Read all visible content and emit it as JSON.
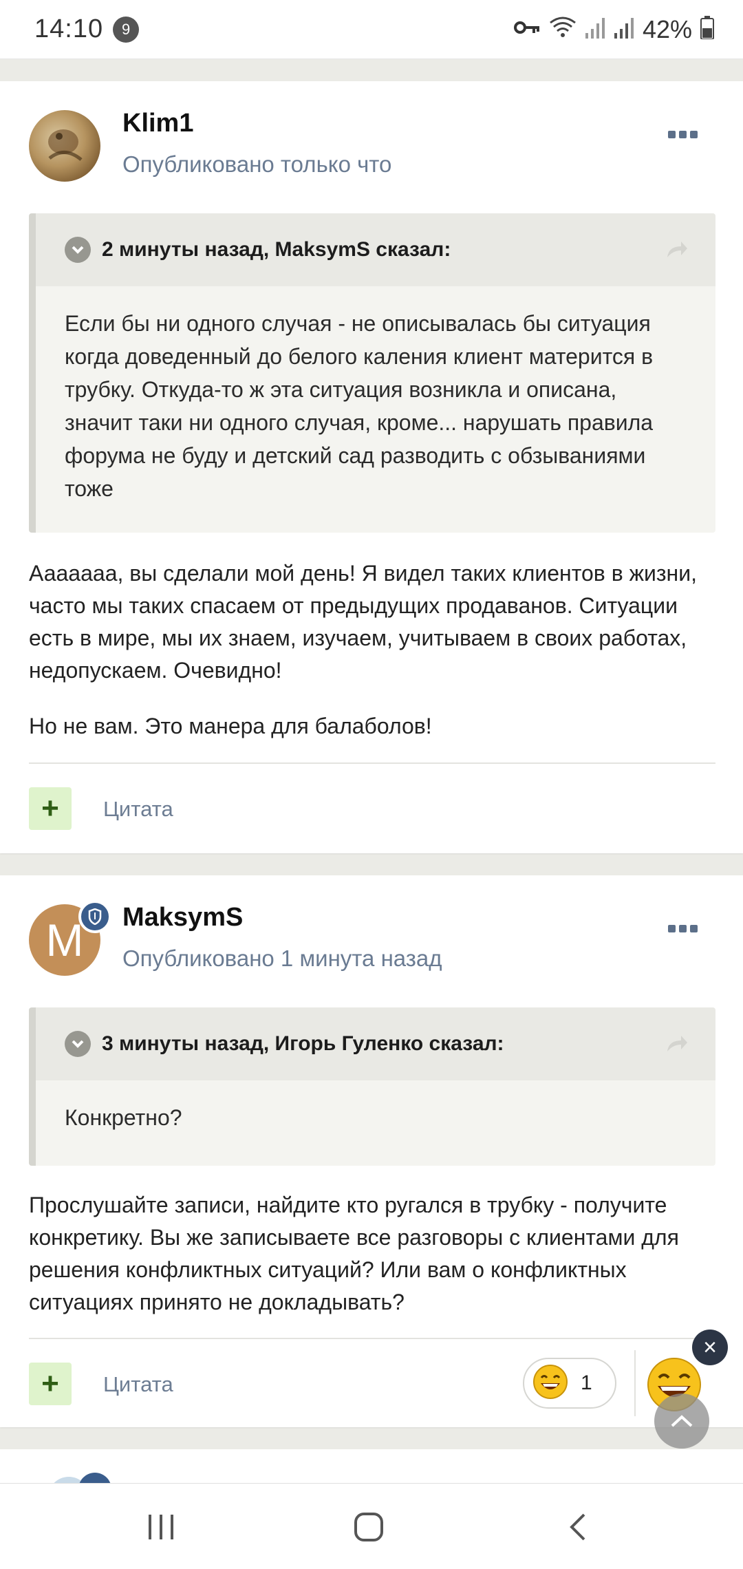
{
  "status_bar": {
    "time": "14:10",
    "notification_count": "9",
    "battery": "42%",
    "icons": [
      "key-icon",
      "wifi-icon",
      "signal-icon",
      "signal-icon",
      "battery-icon"
    ]
  },
  "posts": [
    {
      "author": "Klim1",
      "posted": "Опубликовано только что",
      "quote": {
        "header": "2 минуты назад, MaksymS сказал:",
        "text": "Если бы ни одного случая - не описывалась бы ситуация когда доведенный до белого каления клиент матерится в трубку. Откуда-то ж эта ситуация возникла и описана, значит таки ни одного случая, кроме... нарушать правила форума не буду и детский сад разводить с обзываниями тоже"
      },
      "paragraphs": [
        "Аааааaа, вы сделали мой день! Я видел таких клиентов в жизни, часто мы таких спасаем от предыдущих продаванов. Ситуации есть в мире, мы их знаем, изучаем, учитываем в своих работах, недопускаем. Очевидно!",
        "Но не вам. Это манера для балаболов!"
      ],
      "plus_label": "+",
      "quote_action": "Цитата"
    },
    {
      "author": "MaksymS",
      "avatar_letter": "M",
      "posted": "Опубликовано 1 минута назад",
      "quote": {
        "header": "3 минуты назад, Игорь Гуленко сказал:",
        "text": "Конкретно?"
      },
      "paragraphs": [
        "Прослушайте записи, найдите кто ругался в трубку - получите конкретику. Вы же записываете все разговоры с клиентами для решения конфликтных ситуаций? Или вам о конфликтных ситуациях принято не докладывать?"
      ],
      "plus_label": "+",
      "quote_action": "Цитата",
      "reaction_count": "1"
    }
  ],
  "floating": {
    "close_label": "×"
  },
  "colors": {
    "link_gray": "#6a7b92",
    "plus_bg": "#dff3cc",
    "plus_fg": "#2f5e15",
    "moderator_badge": "#3a5d8c",
    "page_bg": "#ebebe6"
  }
}
